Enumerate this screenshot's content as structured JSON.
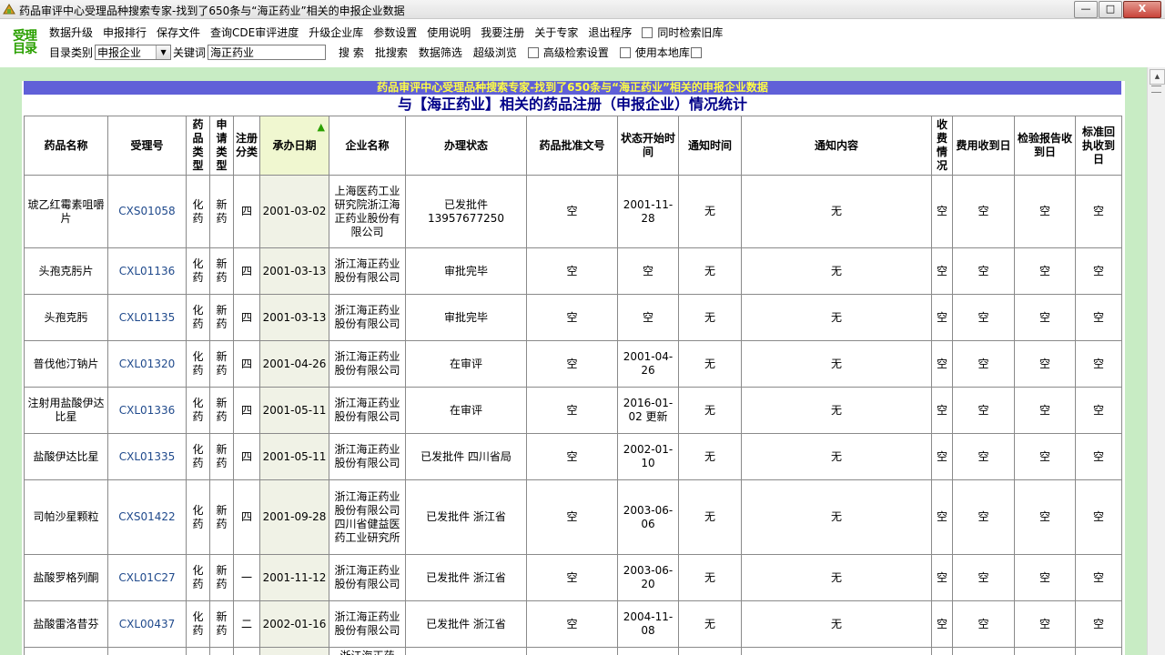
{
  "window": {
    "title": "药品审评中心受理品种搜索专家-找到了650条与“海正药业”相关的申报企业数据",
    "minimize": "—",
    "maximize": "□",
    "close": "X"
  },
  "logo": {
    "line1": "受理",
    "line2": "目录"
  },
  "menu": {
    "items": [
      "数据升级",
      "申报排行",
      "保存文件",
      "查询CDE审评进度",
      "升级企业库",
      "参数设置",
      "使用说明",
      "我要注册",
      "关于专家",
      "退出程序"
    ],
    "history_checkbox_label": "同时检索旧库"
  },
  "search": {
    "category_label": "目录类别",
    "category_value": "申报企业",
    "keyword_label": "关键词",
    "keyword_value": "海正药业",
    "search_button": "搜  索",
    "batch_search": "批搜索",
    "filter": "数据筛选",
    "super_browse": "超级浏览",
    "advanced_label": "高级检索设置",
    "local_label": "使用本地库"
  },
  "banner": "药品审评中心受理品种搜索专家-找到了650条与“海正药业”相关的申报企业数据",
  "heading": "与【海正药业】相关的药品注册（申报企业）情况统计",
  "table": {
    "headers": [
      "药品名称",
      "受理号",
      "药品类型",
      "申请类型",
      "注册分类",
      "承办日期",
      "企业名称",
      "办理状态",
      "药品批准文号",
      "状态开始时间",
      "通知时间",
      "通知内容",
      "收费情况",
      "费用收到日",
      "检验报告收到日",
      "标准回执收到日"
    ],
    "rows": [
      [
        "琥乙红霉素咀嚼片",
        "CXS01058",
        "化药",
        "新药",
        "四",
        "2001-03-02",
        "上海医药工业研究院浙江海正药业股份有限公司",
        "已发批件 13957677250",
        "空",
        "2001-11-28",
        "无",
        "无",
        "空",
        "空",
        "空",
        "空"
      ],
      [
        "头孢克肟片",
        "CXL01136",
        "化药",
        "新药",
        "四",
        "2001-03-13",
        "浙江海正药业股份有限公司",
        "审批完毕",
        "空",
        "空",
        "无",
        "无",
        "空",
        "空",
        "空",
        "空"
      ],
      [
        "头孢克肟",
        "CXL01135",
        "化药",
        "新药",
        "四",
        "2001-03-13",
        "浙江海正药业股份有限公司",
        "审批完毕",
        "空",
        "空",
        "无",
        "无",
        "空",
        "空",
        "空",
        "空"
      ],
      [
        "普伐他汀钠片",
        "CXL01320",
        "化药",
        "新药",
        "四",
        "2001-04-26",
        "浙江海正药业股份有限公司",
        "在审评",
        "空",
        "2001-04-26",
        "无",
        "无",
        "空",
        "空",
        "空",
        "空"
      ],
      [
        "注射用盐酸伊达比星",
        "CXL01336",
        "化药",
        "新药",
        "四",
        "2001-05-11",
        "浙江海正药业股份有限公司",
        "在审评",
        "空",
        "2016-01-02 更新",
        "无",
        "无",
        "空",
        "空",
        "空",
        "空"
      ],
      [
        "盐酸伊达比星",
        "CXL01335",
        "化药",
        "新药",
        "四",
        "2001-05-11",
        "浙江海正药业股份有限公司",
        "已发批件 四川省局",
        "空",
        "2002-01-10",
        "无",
        "无",
        "空",
        "空",
        "空",
        "空"
      ],
      [
        "司帕沙星颗粒",
        "CXS01422",
        "化药",
        "新药",
        "四",
        "2001-09-28",
        "浙江海正药业股份有限公司四川省健益医药工业研究所",
        "已发批件 浙江省",
        "空",
        "2003-06-06",
        "无",
        "无",
        "空",
        "空",
        "空",
        "空"
      ],
      [
        "盐酸罗格列酮",
        "CXL01C27",
        "化药",
        "新药",
        "一",
        "2001-11-12",
        "浙江海正药业股份有限公司",
        "已发批件 浙江省",
        "空",
        "2003-06-20",
        "无",
        "无",
        "空",
        "空",
        "空",
        "空"
      ],
      [
        "盐酸雷洛昔芬",
        "CXL00437",
        "化药",
        "新药",
        "二",
        "2002-01-16",
        "浙江海正药业股份有限公司",
        "已发批件 浙江省",
        "空",
        "2004-11-08",
        "无",
        "无",
        "空",
        "空",
        "空",
        "空"
      ],
      [
        "",
        "",
        "",
        "",
        "",
        "",
        "浙江海正药",
        "",
        "",
        "",
        "",
        "",
        "",
        "",
        "",
        ""
      ]
    ]
  }
}
